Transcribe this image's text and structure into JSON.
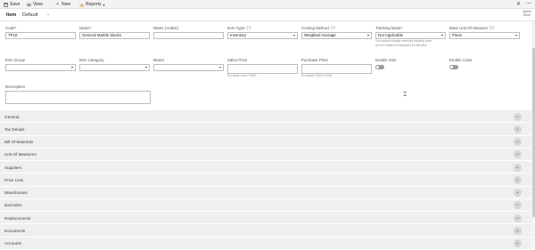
{
  "toolbar": {
    "save_label": "Save",
    "view_label": "View",
    "new_label": "New",
    "reports_label": "Reports"
  },
  "header": {
    "title": "Item",
    "view_name": "Default"
  },
  "user": {
    "name": "Admin",
    "subtitle": "Store"
  },
  "fields": {
    "code": {
      "label": "Code*",
      "value": "TP10"
    },
    "name": {
      "label": "Name*",
      "value": "General Marble blocks"
    },
    "name_arabic": {
      "label": "Name (Arabic)",
      "value": ""
    },
    "item_type": {
      "label": "Item Type ⓘ*",
      "value": "Inventory"
    },
    "costing_method": {
      "label": "Costing Method ⓘ*",
      "value": "Weighted Average"
    },
    "tracking_mode": {
      "label": "Tracking Mode*",
      "value": "Not Applicable",
      "hint_1": "You cannot change inventory tracking once",
      "hint_2": "you've created transactions for this item."
    },
    "base_uom": {
      "label": "Base Unit Of Measure ⓘ*",
      "value": "Piece"
    },
    "item_group": {
      "label": "Item Group",
      "value": ""
    },
    "item_category": {
      "label": "Item Category",
      "value": ""
    },
    "brand": {
      "label": "Brand",
      "value": ""
    },
    "sales_price": {
      "label": "Sales Price",
      "value": "",
      "hint": "Per Base Unit in KWD"
    },
    "purchase_price": {
      "label": "Purchase Price",
      "value": "",
      "hint": "Per Base UOM in KWD"
    },
    "enable_size": {
      "label": "Enable Size",
      "enabled": false
    },
    "enable_color": {
      "label": "Enable Color",
      "enabled": false
    },
    "description": {
      "label": "Description",
      "value": ""
    }
  },
  "sections": [
    {
      "label": "General"
    },
    {
      "label": "Tax Details"
    },
    {
      "label": "Bill Of Materials"
    },
    {
      "label": "Unit Of Measures"
    },
    {
      "label": "Suppliers"
    },
    {
      "label": "Price Lists"
    },
    {
      "label": "Warehouses"
    },
    {
      "label": "Barcodes"
    },
    {
      "label": "Replacements"
    },
    {
      "label": "Documents"
    },
    {
      "label": "Accounts"
    }
  ],
  "icons": {
    "save": "save-icon",
    "view": "eye-icon",
    "new": "plus-icon",
    "reports": "chart-icon"
  },
  "colors": {
    "new_plus": "#2e9c3f",
    "reports_icon": "#e0a000",
    "section_bg": "#efefef"
  }
}
